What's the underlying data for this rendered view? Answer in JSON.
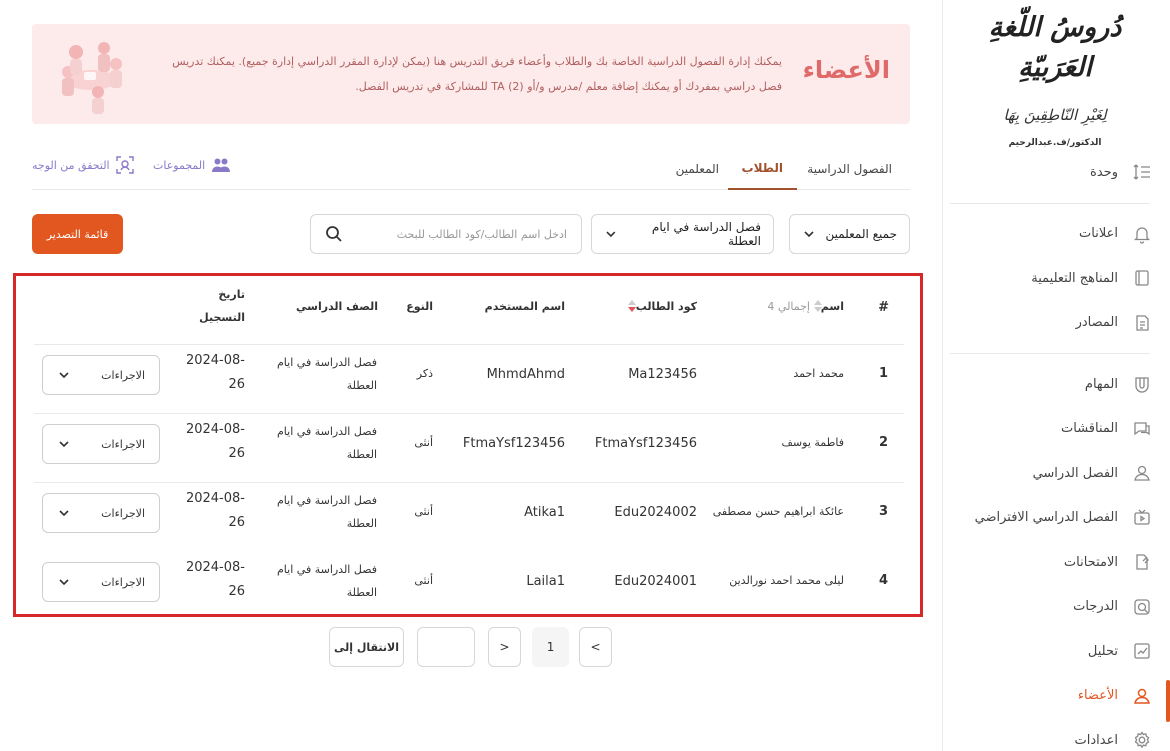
{
  "sidebar": {
    "logo": {
      "line1": "دُروسُ اللّغةِ العَرَبيّةِ",
      "line2": "لِغَيْرِ النّاطِقِينَ بِهَا",
      "line3": "الدكتور/ف.عبدالرحيم"
    },
    "items": [
      {
        "label": "وحدة",
        "icon": "unit-icon"
      },
      {
        "label": "اعلانات",
        "icon": "bell-icon"
      },
      {
        "label": "المناهج التعليمية",
        "icon": "book-icon"
      },
      {
        "label": "المصادر",
        "icon": "resources-icon"
      },
      {
        "label": "المهام",
        "icon": "tasks-icon"
      },
      {
        "label": "المناقشات",
        "icon": "discussion-icon"
      },
      {
        "label": "الفصل الدراسي",
        "icon": "classroom-icon"
      },
      {
        "label": "الفصل الدراسي الافتراضي",
        "icon": "virtual-class-icon"
      },
      {
        "label": "الامتحانات",
        "icon": "exams-icon"
      },
      {
        "label": "الدرجات",
        "icon": "grades-icon"
      },
      {
        "label": "تحليل",
        "icon": "analytics-icon"
      },
      {
        "label": "الأعضاء",
        "icon": "members-icon"
      },
      {
        "label": "اعدادات",
        "icon": "settings-icon"
      }
    ],
    "active_color": "#e2571f"
  },
  "banner": {
    "title": "الأعضاء",
    "text": "يمكنك إدارة الفصول الدراسية الخاصة بك والطلاب وأعضاء فريق التدريس هنا (يمكن لإدارة المقرر الدراسي إدارة جميع). يمكنك تدريس فصل دراسي بمفردك أو يمكنك إضافة معلم /مدرس و/أو (2) TA للمشاركة في تدريس الفصل."
  },
  "tabs": [
    "الفصول الدراسية",
    "الطلاب",
    "المعلمين"
  ],
  "quick_links": {
    "groups": "المجموعات",
    "face_verify": "التحقق من الوجه"
  },
  "filters": {
    "teachers": "جميع المعلمين",
    "class": "فصل الدراسة في ايام العطلة",
    "search_placeholder": "ادخل اسم الطالب/كود الطالب للبحث",
    "export_label": "قائمة التصدير"
  },
  "table": {
    "headers": {
      "index": "#",
      "name": "اسم",
      "total": "إجمالي 4",
      "code": "كود الطالب",
      "username": "اسم المستخدم",
      "gender": "النوع",
      "class": "الصف الدراسي",
      "date_line1": "تاريخ",
      "date_line2": "التسجيل"
    },
    "rows": [
      {
        "index": "1",
        "name": "محمد احمد",
        "code": "Ma123456",
        "username": "MhmdAhmd",
        "gender": "ذكر",
        "class_line1": "فصل الدراسة في ايام",
        "class_line2": "العطلة",
        "date_line1": "-2024-08",
        "date_line2": "26",
        "action": "الاجراءات"
      },
      {
        "index": "2",
        "name": "فاطمة يوسف",
        "code": "FtmaYsf123456",
        "username": "FtmaYsf123456",
        "gender": "أنثى",
        "class_line1": "فصل الدراسة في ايام",
        "class_line2": "العطلة",
        "date_line1": "-2024-08",
        "date_line2": "26",
        "action": "الاجراءات"
      },
      {
        "index": "3",
        "name": "عائكة ابراهيم حسن مصطفى",
        "code": "Edu2024002",
        "username": "Atika1",
        "gender": "أنثى",
        "class_line1": "فصل الدراسة في ايام",
        "class_line2": "العطلة",
        "date_line1": "-2024-08",
        "date_line2": "26",
        "action": "الاجراءات"
      },
      {
        "index": "4",
        "name": "ليلى محمد احمد نورالدين",
        "code": "Edu2024001",
        "username": "Laila1",
        "gender": "أنثى",
        "class_line1": "فصل الدراسة في ايام",
        "class_line2": "العطلة",
        "date_line1": "-2024-08",
        "date_line2": "26",
        "action": "الاجراءات"
      }
    ]
  },
  "pagination": {
    "prev": ">",
    "current": "1",
    "next": "<",
    "goto_label": "الانتقال إلى",
    "goto_value": ""
  }
}
